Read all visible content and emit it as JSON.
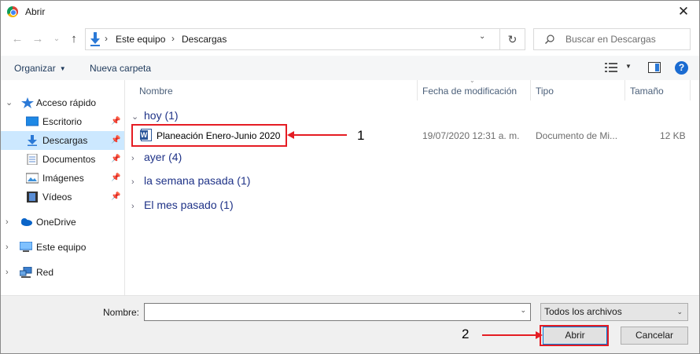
{
  "window": {
    "title": "Abrir",
    "close_glyph": "✕"
  },
  "nav": {
    "back": "←",
    "forward": "→",
    "recent": "⌄",
    "up": "↑"
  },
  "address": {
    "root_sep": "›",
    "crumbs": [
      "Este equipo",
      "Descargas"
    ],
    "crumb_sep": "›",
    "drop": "⌄",
    "refresh": "↻"
  },
  "search": {
    "placeholder": "Buscar en Descargas"
  },
  "toolbar": {
    "organize": "Organizar",
    "organize_caret": "▼",
    "new_folder": "Nueva carpeta",
    "view_caret": "▼",
    "help": "?"
  },
  "sidebar": {
    "quick_access": "Acceso rápido",
    "items": [
      {
        "label": "Escritorio",
        "pin": "📌"
      },
      {
        "label": "Descargas",
        "pin": "📌"
      },
      {
        "label": "Documentos",
        "pin": "📌"
      },
      {
        "label": "Imágenes",
        "pin": "📌"
      },
      {
        "label": "Vídeos",
        "pin": "📌"
      }
    ],
    "onedrive": "OneDrive",
    "this_pc": "Este equipo",
    "network": "Red",
    "expand_glyph": "›",
    "expanded_glyph": "⌄"
  },
  "columns": {
    "name": "Nombre",
    "date": "Fecha de modificación",
    "type": "Tipo",
    "size": "Tamaño",
    "sort_glyph": "⌄"
  },
  "groups": [
    {
      "label": "hoy (1)",
      "chev": "⌄"
    },
    {
      "label": "ayer (4)",
      "chev": "›"
    },
    {
      "label": "la semana pasada (1)",
      "chev": "›"
    },
    {
      "label": "El mes pasado (1)",
      "chev": "›"
    }
  ],
  "files": [
    {
      "name": "Planeación Enero-Junio 2020",
      "date": "19/07/2020 12:31 a. m.",
      "type": "Documento de Mi...",
      "size": "12 KB"
    }
  ],
  "annotations": {
    "step1": "1",
    "step2": "2",
    "highlight_color": "#e51c23"
  },
  "bottom": {
    "name_label": "Nombre:",
    "name_value": "",
    "name_drop": "⌄",
    "filter": "Todos los archivos",
    "filter_drop": "⌄",
    "open": "Abrir",
    "cancel": "Cancelar"
  },
  "colors": {
    "selection": "#cce8ff",
    "group_text": "#1e3287",
    "accent": "#0078d7"
  }
}
